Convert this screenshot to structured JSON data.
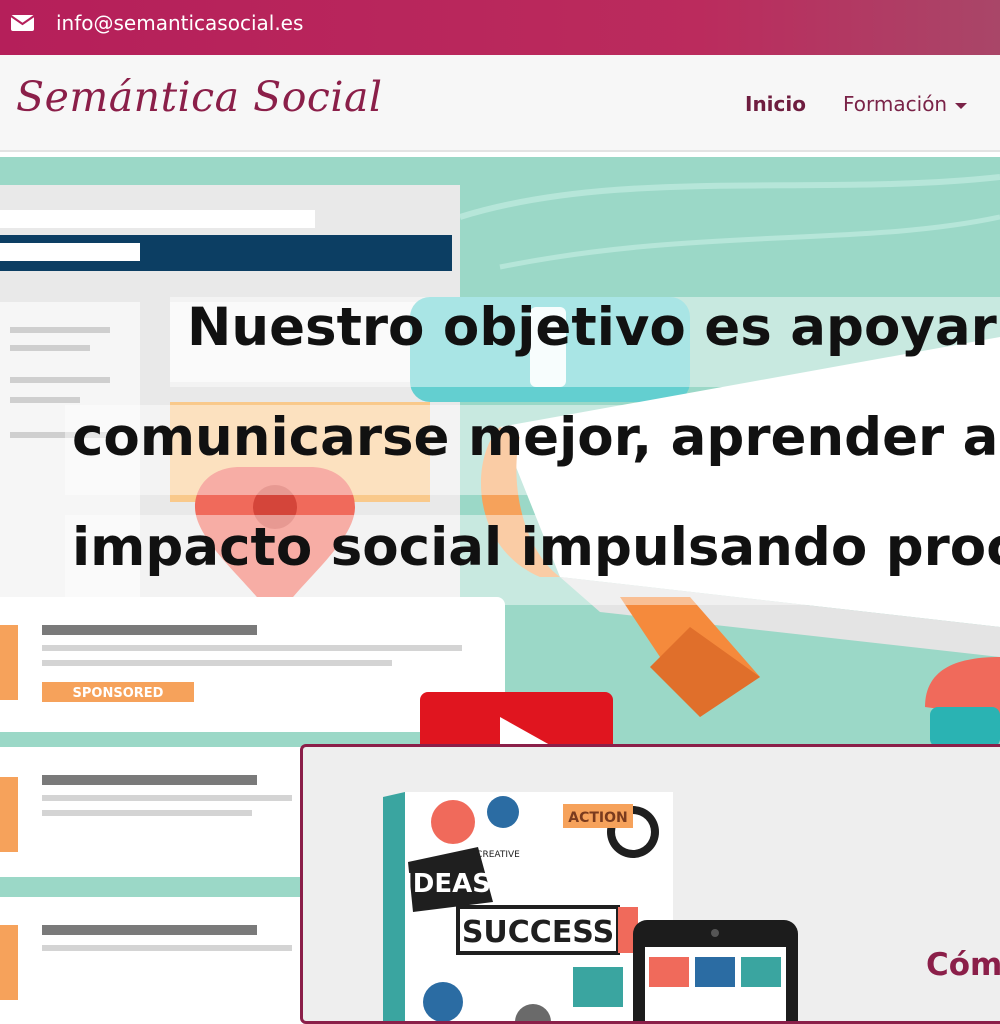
{
  "topbar": {
    "email": "info@semanticasocial.es",
    "icon": "envelope-icon",
    "color": "#b51f5a"
  },
  "navbar": {
    "brand": "Semántica Social",
    "items": [
      {
        "label": "Inicio",
        "active": true
      },
      {
        "label": "Formación",
        "dropdown": true
      }
    ]
  },
  "hero": {
    "lines": [
      "Nuestro objetivo es apoyar a",
      "comunicarse mejor, aprender a c",
      "impacto social impulsando proce"
    ],
    "illustration_labels": {
      "sponsored": "SPONSORED"
    },
    "background": "#9bd8c7"
  },
  "promo": {
    "title": "Cómo",
    "book_words": [
      "IDEAS",
      "SUCCESS",
      "ACTION",
      "CREATIVE"
    ]
  },
  "colors": {
    "brand": "#8b1f49",
    "accent": "#b51f5a"
  }
}
